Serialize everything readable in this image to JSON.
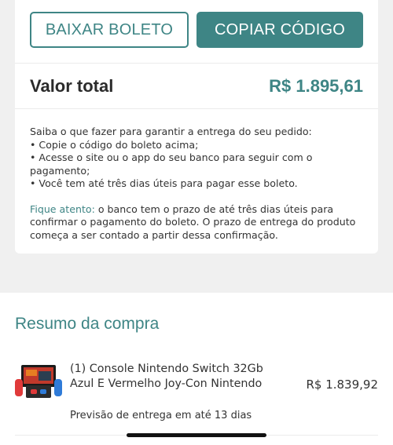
{
  "actions": {
    "download_label": "BAIXAR BOLETO",
    "copy_label": "COPIAR CÓDIGO"
  },
  "total": {
    "label": "Valor total",
    "value": "R$ 1.895,61"
  },
  "instructions": {
    "intro": "Saiba o que fazer para garantir a entrega do seu pedido:",
    "steps": [
      "• Copie o código do boleto acima;",
      "• Acesse o site ou o app do seu banco para seguir com o\npagamento;",
      "• Você tem até três dias úteis para pagar esse boleto."
    ],
    "warning_title": "Fique atento:",
    "warning_text": " o banco tem o prazo de até três dias úteis para confirmar o pagamento do boleto. O prazo de entrega do produto começa a ser contado a partir dessa confirmação."
  },
  "summary": {
    "title": "Resumo da compra",
    "items": [
      {
        "name": "(1) Console Nintendo Switch 32Gb Azul E Vermelho Joy-Con Nintendo",
        "price": "R$ 1.839,92",
        "delivery": "Previsão de entrega em até 13 dias",
        "image_icon": "nintendo-switch-console-image"
      }
    ]
  },
  "colors": {
    "accent": "#3e8585",
    "background": "#f0f0f0",
    "card": "#ffffff"
  }
}
